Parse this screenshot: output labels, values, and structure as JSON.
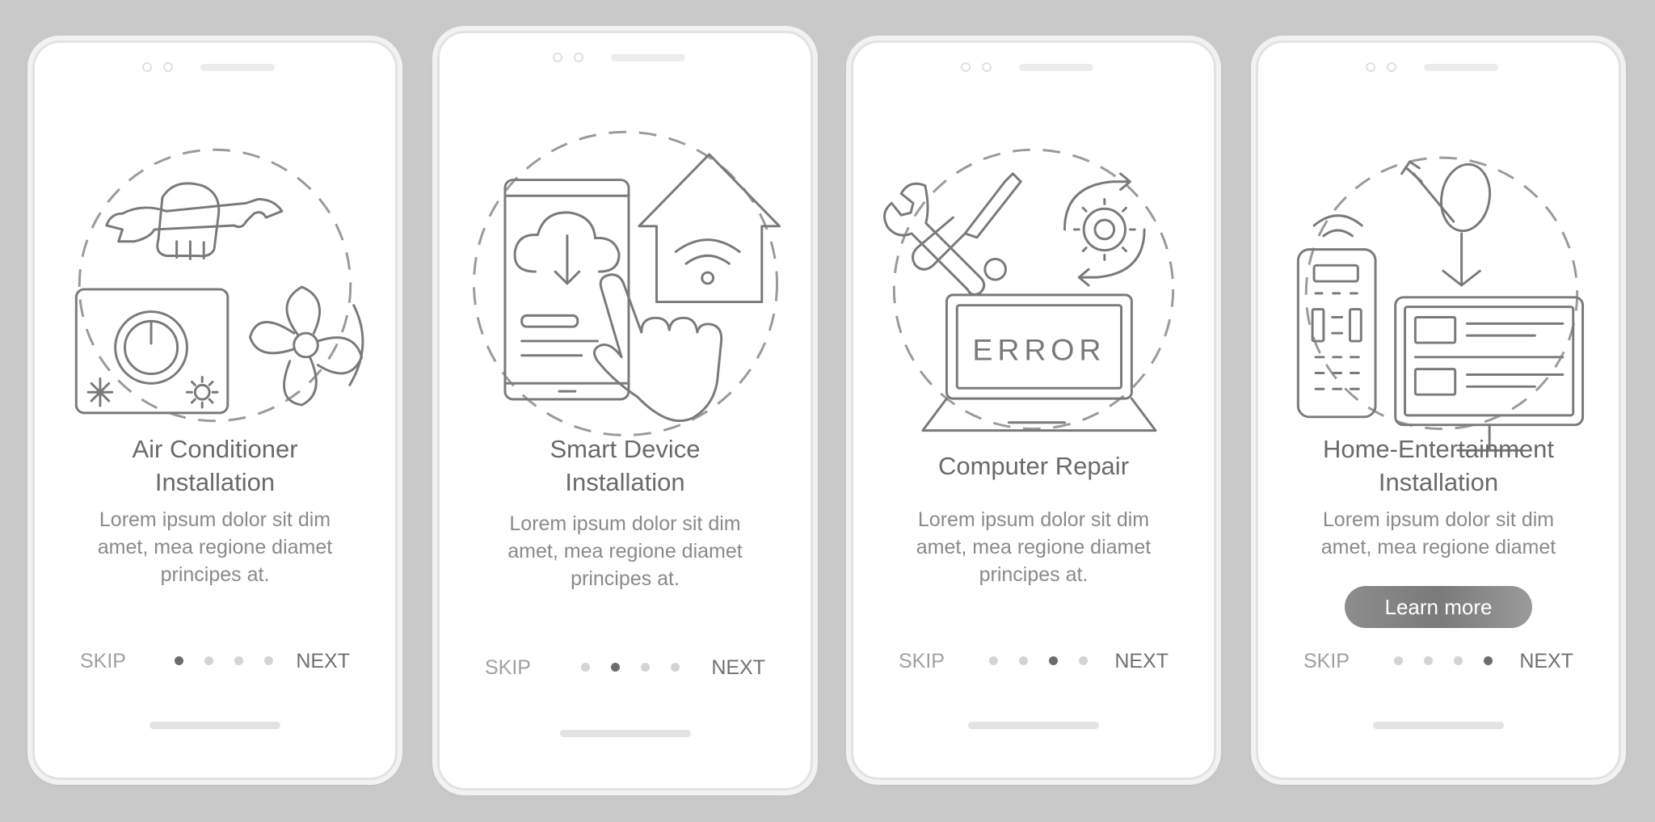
{
  "screens": [
    {
      "title_line1": "Air Conditioner",
      "title_line2": "Installation",
      "description": [
        "Lorem ipsum dolor sit dim",
        "amet, mea regione diamet",
        "principes at."
      ],
      "skip_label": "SKIP",
      "next_label": "NEXT",
      "active_page": 1,
      "page_count": 4
    },
    {
      "title_line1": "Smart Device",
      "title_line2": "Installation",
      "description": [
        "Lorem ipsum dolor sit dim",
        "amet, mea regione diamet",
        "principes at."
      ],
      "skip_label": "SKIP",
      "next_label": "NEXT",
      "active_page": 2,
      "page_count": 4
    },
    {
      "title_line1": "Computer Repair",
      "description": [
        "Lorem ipsum dolor sit dim",
        "amet, mea regione diamet",
        "principes at."
      ],
      "laptop_screen_text": "ERROR",
      "skip_label": "SKIP",
      "next_label": "NEXT",
      "active_page": 3,
      "page_count": 4
    },
    {
      "title_line1": "Home-Entertainment",
      "title_line2": "Installation",
      "description": [
        "Lorem ipsum dolor sit dim",
        "amet, mea regione diamet"
      ],
      "learn_more_label": "Learn more",
      "skip_label": "SKIP",
      "next_label": "NEXT",
      "active_page": 4,
      "page_count": 4
    }
  ],
  "colors": {
    "background": "#c9c9c9",
    "screen": "#ffffff",
    "title_text": "#6a6a6a",
    "body_text": "#8a8a8a",
    "dot_active": "#6c6c6c",
    "dot_inactive": "#d4d4d4",
    "button": "#8a8a8a"
  },
  "icons": {
    "screen1": [
      "wrench-hand-icon",
      "air-conditioner-unit-icon",
      "fan-icon",
      "snowflake-icon",
      "sun-icon"
    ],
    "screen2": [
      "smartphone-icon",
      "cloud-download-icon",
      "smart-home-wifi-icon",
      "pointing-hand-icon"
    ],
    "screen3": [
      "wrench-screwdriver-icon",
      "gear-refresh-icon",
      "laptop-icon"
    ],
    "screen4": [
      "remote-control-icon",
      "satellite-dish-icon",
      "tv-monitor-icon"
    ]
  }
}
